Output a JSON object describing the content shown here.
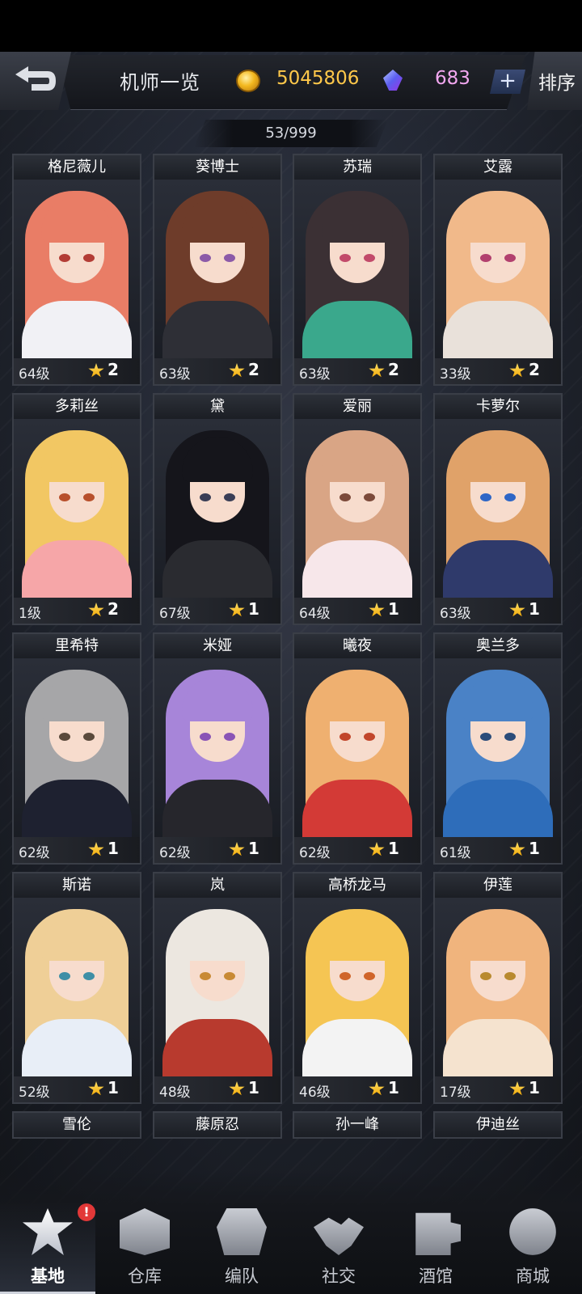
{
  "header": {
    "title": "机师一览",
    "coins": "5045806",
    "gems": "683",
    "gem_add_label": "+",
    "sort_label": "排序"
  },
  "pilot_count": "53/999",
  "cards": [
    {
      "name": "格尼薇儿",
      "level": "64级",
      "stars": "2",
      "hair": "#e97d66",
      "body": "#f1f1f5",
      "eye": "#b33c35"
    },
    {
      "name": "葵博士",
      "level": "63级",
      "stars": "2",
      "hair": "#6e3c2a",
      "body": "#2e2f36",
      "eye": "#8c5aa8"
    },
    {
      "name": "苏瑞",
      "level": "63级",
      "stars": "2",
      "hair": "#3b3034",
      "body": "#3aa88c",
      "eye": "#c24a6a"
    },
    {
      "name": "艾露",
      "level": "33级",
      "stars": "2",
      "hair": "#f1b98a",
      "body": "#e9e1da",
      "eye": "#b2406e"
    },
    {
      "name": "多莉丝",
      "level": "1级",
      "stars": "2",
      "hair": "#f2c763",
      "body": "#f6a6a8",
      "eye": "#b8502c"
    },
    {
      "name": "黛",
      "level": "67级",
      "stars": "1",
      "hair": "#15151b",
      "body": "#2a2b30",
      "eye": "#3a3e56"
    },
    {
      "name": "爱丽",
      "level": "64级",
      "stars": "1",
      "hair": "#d9a585",
      "body": "#f7e7ea",
      "eye": "#7c4a3a"
    },
    {
      "name": "卡萝尔",
      "level": "63级",
      "stars": "1",
      "hair": "#e0a269",
      "body": "#2f3a6b",
      "eye": "#2e66c6"
    },
    {
      "name": "里希特",
      "level": "62级",
      "stars": "1",
      "hair": "#a6a6a8",
      "body": "#1e2130",
      "eye": "#5a4a3c"
    },
    {
      "name": "米娅",
      "level": "62级",
      "stars": "1",
      "hair": "#a785d9",
      "body": "#26262c",
      "eye": "#8a54b6"
    },
    {
      "name": "曦夜",
      "level": "62级",
      "stars": "1",
      "hair": "#efb070",
      "body": "#d33a36",
      "eye": "#c2462b"
    },
    {
      "name": "奥兰多",
      "level": "61级",
      "stars": "1",
      "hair": "#4a82c6",
      "body": "#2e6dba",
      "eye": "#2b4c7a"
    },
    {
      "name": "斯诺",
      "level": "52级",
      "stars": "1",
      "hair": "#efcf97",
      "body": "#e8eef7",
      "eye": "#3f8fa6"
    },
    {
      "name": "岚",
      "level": "48级",
      "stars": "1",
      "hair": "#ece7e0",
      "body": "#b83a2e",
      "eye": "#c88a35"
    },
    {
      "name": "高桥龙马",
      "level": "46级",
      "stars": "1",
      "hair": "#f5c553",
      "body": "#f3f3f3",
      "eye": "#d0652a"
    },
    {
      "name": "伊莲",
      "level": "17级",
      "stars": "1",
      "hair": "#f0b47d",
      "body": "#f5e3cf",
      "eye": "#b98a2f"
    }
  ],
  "cut_cards": [
    {
      "name": "雪伦"
    },
    {
      "name": "藤原忍"
    },
    {
      "name": "孙一峰"
    },
    {
      "name": "伊迪丝"
    }
  ],
  "nav": [
    {
      "label": "基地",
      "icon": "base-emblem-icon",
      "active": true,
      "badge": "!"
    },
    {
      "label": "仓库",
      "icon": "warehouse-icon"
    },
    {
      "label": "编队",
      "icon": "formation-helmet-icon"
    },
    {
      "label": "社交",
      "icon": "handshake-icon"
    },
    {
      "label": "酒馆",
      "icon": "beer-mug-icon"
    },
    {
      "label": "商城",
      "icon": "shop-icon"
    }
  ]
}
